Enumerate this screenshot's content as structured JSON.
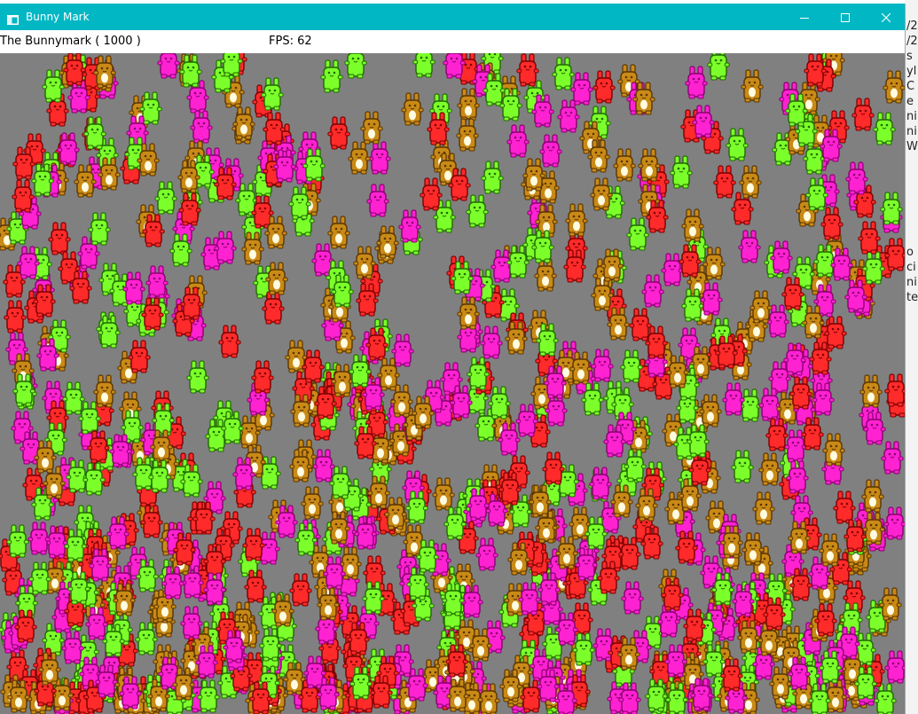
{
  "window": {
    "title": "Bunny Mark",
    "controls": {
      "minimize": "minimize",
      "maximize": "maximize",
      "close": "close"
    }
  },
  "hud": {
    "title": "The Bunnymark ( 1000 )",
    "fps": "FPS: 62"
  },
  "game": {
    "bunny_count": 1000,
    "background_color": "#808080",
    "bunny_colors": {
      "red": "#ff2a2a",
      "pink": "#ff22d2",
      "green": "#7cff2a",
      "orange": "#c98a16"
    }
  },
  "background_window": {
    "lines": [
      "/2",
      "/2",
      "s",
      "yl",
      "C",
      "e",
      "ni",
      "ni",
      "W",
      "",
      "",
      "",
      "",
      "",
      "",
      "o",
      "ci",
      "ni",
      "te"
    ]
  },
  "icons": {
    "app": "app-window-icon",
    "minimize": "minimize-icon",
    "maximize": "maximize-icon",
    "close": "close-icon"
  }
}
